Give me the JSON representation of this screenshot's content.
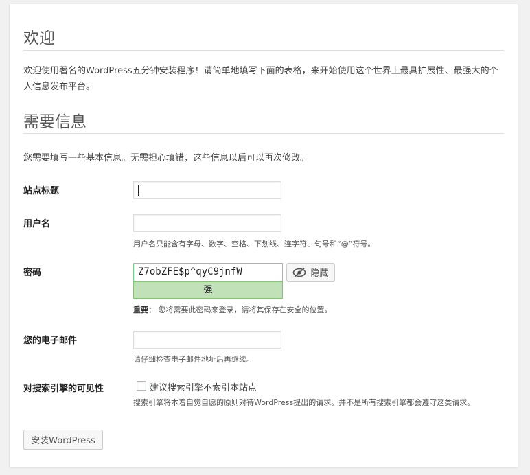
{
  "welcome": {
    "title": "欢迎",
    "intro": "欢迎使用著名的WordPress五分钟安装程序！请简单地填写下面的表格，来开始使用这个世界上最具扩展性、最强大的个人信息发布平台。"
  },
  "info": {
    "title": "需要信息",
    "note": "您需要填写一些基本信息。无需担心填错，这些信息以后可以再次修改。"
  },
  "fields": {
    "site_title_label": "站点标题",
    "site_title_value": "",
    "username_label": "用户名",
    "username_value": "",
    "username_hint": "用户名只能含有字母、数字、空格、下划线、连字符、句号和“@”符号。",
    "password_label": "密码",
    "password_value": "Z7obZFE$p^qyC9jnfW",
    "password_strength": "强",
    "hide_button": "隐藏",
    "password_important": "重要：",
    "password_note": "您将需要此密码来登录，请将其保存在安全的位置。",
    "email_label": "您的电子邮件",
    "email_value": "",
    "email_hint": "请仔细检查电子邮件地址后再继续。",
    "visibility_label": "对搜索引擎的可见性",
    "visibility_checkbox": "建议搜索引擎不索引本站点",
    "visibility_hint": "搜索引擎将本着自觉自愿的原则对待WordPress提出的请求。并不是所有搜索引擎都会遵守这类请求。"
  },
  "install_button": "安装WordPress",
  "icons": {
    "hide": "eye-slash-icon"
  },
  "colors": {
    "strength_bg": "#c1e1b9",
    "strength_border": "#83c373",
    "password_border": "#68de7c"
  }
}
